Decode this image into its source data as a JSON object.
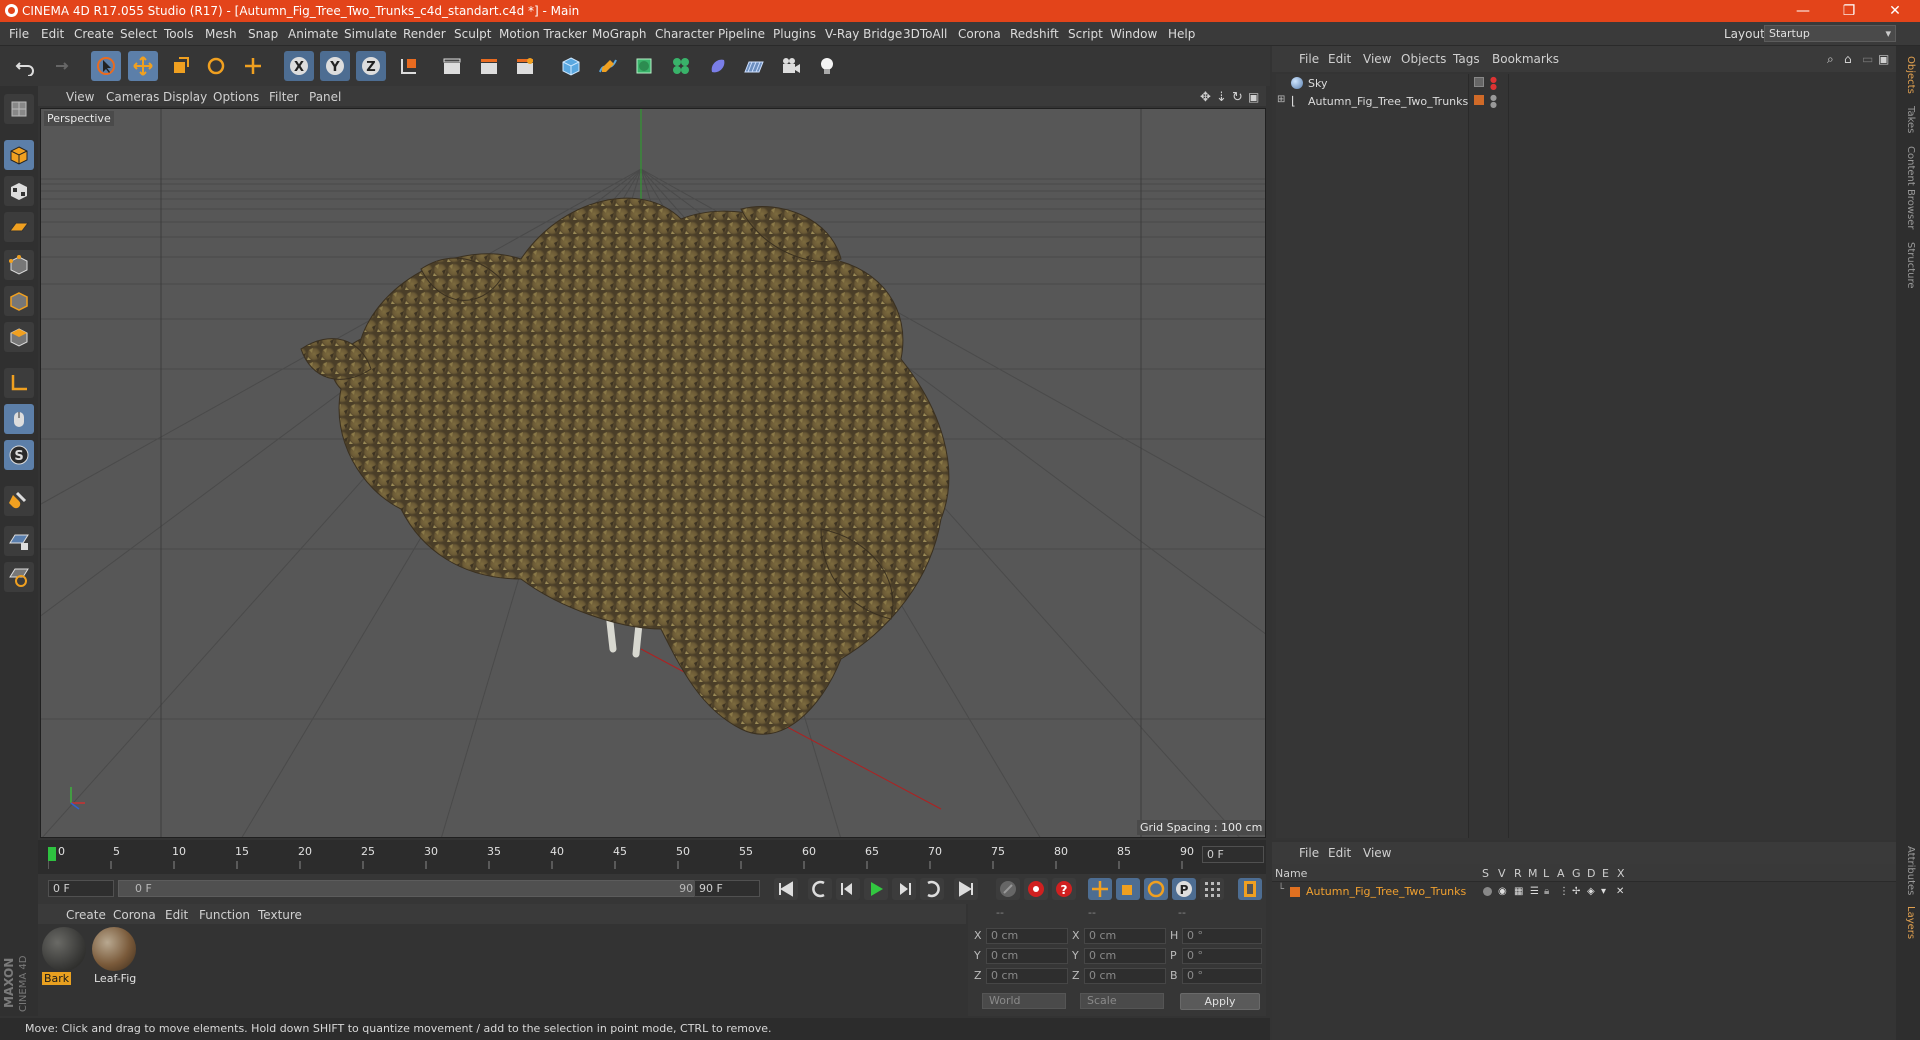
{
  "window": {
    "title": "CINEMA 4D R17.055 Studio (R17) - [Autumn_Fig_Tree_Two_Trunks_c4d_standart.c4d *] - Main",
    "minimize": "—",
    "restore": "❐",
    "close": "✕"
  },
  "menu": [
    "File",
    "Edit",
    "Create",
    "Select",
    "Tools",
    "Mesh",
    "Snap",
    "Animate",
    "Simulate",
    "Render",
    "Sculpt",
    "Motion Tracker",
    "MoGraph",
    "Character",
    "Pipeline",
    "Plugins",
    "V-Ray Bridge",
    "3DToAll",
    "Corona",
    "Redshift",
    "Script",
    "Window",
    "Help"
  ],
  "layout": {
    "label": "Layout:",
    "value": "Startup"
  },
  "viewport": {
    "menu": [
      "View",
      "Cameras",
      "Display",
      "Options",
      "Filter",
      "Panel"
    ],
    "camera_label": "Perspective",
    "grid_spacing": "Grid Spacing : 100 cm"
  },
  "timeline": {
    "ticks": [
      "0",
      "5",
      "10",
      "15",
      "20",
      "25",
      "30",
      "35",
      "40",
      "45",
      "50",
      "55",
      "60",
      "65",
      "70",
      "75",
      "80",
      "85",
      "90"
    ],
    "current_frame_right": "0 F",
    "start_field": "0 F",
    "range_start": "0 F",
    "range_end": "90 F",
    "end_field": "90 F"
  },
  "materials": {
    "menu": [
      "Create",
      "Corona",
      "Edit",
      "Function",
      "Texture"
    ],
    "items": [
      {
        "name": "Bark"
      },
      {
        "name": "Leaf-Fig"
      }
    ]
  },
  "coords": {
    "headers": [
      "--",
      "--",
      "--"
    ],
    "rows": [
      {
        "a": "X",
        "av": "0 cm",
        "b": "X",
        "bv": "0 cm",
        "c": "H",
        "cv": "0 °"
      },
      {
        "a": "Y",
        "av": "0 cm",
        "b": "Y",
        "bv": "0 cm",
        "c": "P",
        "cv": "0 °"
      },
      {
        "a": "Z",
        "av": "0 cm",
        "b": "Z",
        "bv": "0 cm",
        "c": "B",
        "cv": "0 °"
      }
    ],
    "world": "World",
    "scale": "Scale",
    "apply": "Apply"
  },
  "status": "Move: Click and drag to move elements. Hold down SHIFT to quantize movement / add to the selection in point mode, CTRL to remove.",
  "objects": {
    "menu": [
      "File",
      "Edit",
      "View",
      "Objects",
      "Tags",
      "Bookmarks"
    ],
    "items": [
      {
        "name": "Sky"
      },
      {
        "name": "Autumn_Fig_Tree_Two_Trunks"
      }
    ]
  },
  "layers": {
    "menu": [
      "File",
      "Edit",
      "View"
    ],
    "header_name": "Name",
    "columns": [
      "S",
      "V",
      "R",
      "M",
      "L",
      "A",
      "G",
      "D",
      "E",
      "X"
    ],
    "items": [
      {
        "name": "Autumn_Fig_Tree_Two_Trunks",
        "color": "#e07020"
      }
    ]
  },
  "right_tabs": [
    "Objects",
    "Takes",
    "Content Browser",
    "Structure",
    "Attributes",
    "Layers"
  ],
  "brand": {
    "maxon": "MAXON",
    "product": "CINEMA 4D"
  },
  "colors": {
    "accent": "#e3441a",
    "selected": "#5c7fa9",
    "orange_text": "#f0a030"
  }
}
